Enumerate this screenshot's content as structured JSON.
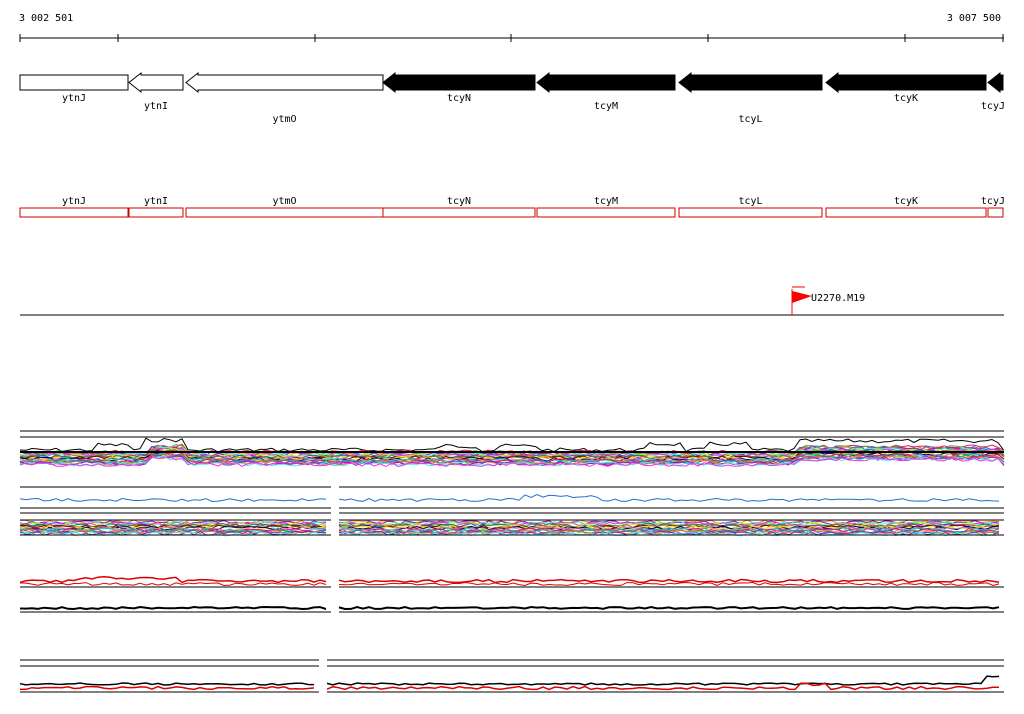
{
  "ruler": {
    "start_label": "3 002 501",
    "end_label": "3 007 500"
  },
  "genes": [
    {
      "name": "ytnJ",
      "strand": "+",
      "fill": "white"
    },
    {
      "name": "ytnI",
      "strand": "-",
      "fill": "white"
    },
    {
      "name": "ytmO",
      "strand": "-",
      "fill": "white"
    },
    {
      "name": "tcyN",
      "strand": "-",
      "fill": "black"
    },
    {
      "name": "tcyM",
      "strand": "-",
      "fill": "black"
    },
    {
      "name": "tcyL",
      "strand": "-",
      "fill": "black"
    },
    {
      "name": "tcyK",
      "strand": "-",
      "fill": "black"
    },
    {
      "name": "tcyJ",
      "strand": "-",
      "fill": "black"
    }
  ],
  "marker": {
    "label": "U2270.M19",
    "color": "#ff0000"
  },
  "colors": {
    "feature_outline": "#cc0000",
    "signal_red": "#dd0000",
    "signal_blue": "#1f6fd1"
  },
  "palette": [
    "#e6194b",
    "#3cb44b",
    "#4363d8",
    "#f58231",
    "#911eb4",
    "#46f0f0",
    "#f032e6",
    "#bcf60c",
    "#008080",
    "#9a6324",
    "#800000",
    "#ffe119",
    "#000075",
    "#e377c2",
    "#17becf"
  ]
}
